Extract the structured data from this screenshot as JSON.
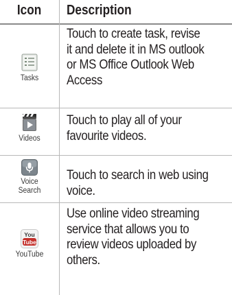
{
  "header": {
    "icon_col": "Icon",
    "desc_col": "Description"
  },
  "rows": [
    {
      "icon": "tasks-icon",
      "label": "Tasks",
      "lines": [
        "Touch to create task, revise",
        "it and delete it in MS outlook",
        "or MS Office Outlook Web",
        "Access"
      ]
    },
    {
      "icon": "videos-icon",
      "label": "Videos",
      "lines": [
        "Touch to play all of your",
        "favourite videos."
      ]
    },
    {
      "icon": "voice-search-icon",
      "label_lines": [
        "Voice",
        "Search"
      ],
      "lines": [
        "Touch to search in web using",
        "voice."
      ]
    },
    {
      "icon": "youtube-icon",
      "label": "YouTube",
      "icon_text": [
        "You",
        "Tube"
      ],
      "lines": [
        "Use online video streaming",
        "service that allows you to",
        "review videos uploaded by",
        "others."
      ]
    }
  ]
}
